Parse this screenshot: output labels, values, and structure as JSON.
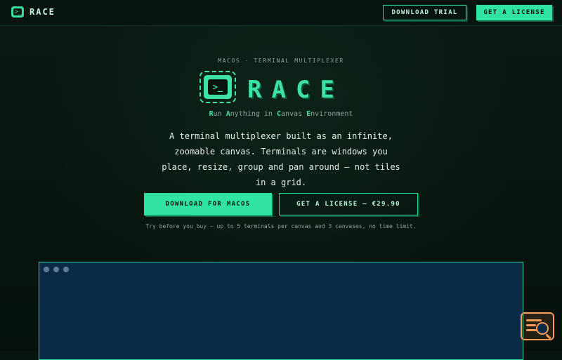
{
  "header": {
    "brand": "RACE",
    "download_trial": "DOWNLOAD TRIAL",
    "get_license": "GET A LICENSE",
    "logo_glyph": ">_"
  },
  "hero": {
    "kicker": "MACOS · TERMINAL MULTIPLEXER",
    "logo_glyph": ">_",
    "wordmark_letters": [
      "R",
      "A",
      "C",
      "E"
    ],
    "tagline_parts": [
      {
        "text": "R",
        "hl": true
      },
      {
        "text": "un ",
        "hl": false
      },
      {
        "text": "A",
        "hl": true
      },
      {
        "text": "nything in ",
        "hl": false
      },
      {
        "text": "C",
        "hl": true
      },
      {
        "text": "anvas ",
        "hl": false
      },
      {
        "text": "E",
        "hl": true
      },
      {
        "text": "nvironment",
        "hl": false
      }
    ],
    "description": "A terminal multiplexer built as an infinite, zoomable canvas. Terminals are windows you place, resize, group and pan around — not tiles in a grid.",
    "cta_download": "DOWNLOAD FOR MACOS",
    "cta_license": "GET A LICENSE — €29.90",
    "note": "Try before you buy — up to 5 terminals per canvas and 3 canvases, no time limit."
  },
  "icons": {
    "brand_logo": "terminal-icon",
    "corner": "search-log-icon"
  },
  "colors": {
    "accent": "#3ee2a4",
    "background": "#07140f",
    "preview": "#0a2a46",
    "corner_icon": "#ff9b59"
  }
}
